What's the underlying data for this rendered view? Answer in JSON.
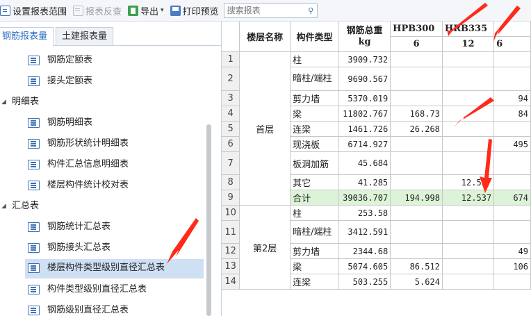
{
  "toolbar": {
    "settings_label": "设置报表范围",
    "check_label": "报表反查",
    "export_label": "导出",
    "print_label": "打印预览",
    "search_placeholder": "搜索报表"
  },
  "tabs": [
    {
      "label": "钢筋报表量",
      "active": true
    },
    {
      "label": "土建报表量",
      "active": false
    }
  ],
  "tree": {
    "items": [
      {
        "type": "doc",
        "label": "钢筋定额表"
      },
      {
        "type": "doc",
        "label": "接头定额表"
      },
      {
        "type": "group",
        "label": "明细表"
      },
      {
        "type": "doc",
        "label": "钢筋明细表"
      },
      {
        "type": "doc",
        "label": "钢筋形状统计明细表"
      },
      {
        "type": "doc",
        "label": "构件汇总信息明细表"
      },
      {
        "type": "doc",
        "label": "楼层构件统计校对表"
      },
      {
        "type": "group",
        "label": "汇总表"
      },
      {
        "type": "doc",
        "label": "钢筋统计汇总表"
      },
      {
        "type": "doc",
        "label": "钢筋接头汇总表"
      },
      {
        "type": "doc",
        "label": "楼层构件类型级别直径汇总表",
        "selected": true
      },
      {
        "type": "doc",
        "label": "构件类型级别直径汇总表"
      },
      {
        "type": "doc",
        "label": "钢筋级别直径汇总表"
      }
    ]
  },
  "table": {
    "headers": {
      "floor": "楼层名称",
      "type": "构件类型",
      "total_line1": "钢筋总重",
      "total_line2": "kg",
      "hpb300": "HPB300",
      "hrb335": "HRB335",
      "d6": "6",
      "d12": "12",
      "d6b": "6"
    },
    "rows": [
      {
        "n": "1",
        "floor": "首层",
        "type": "柱",
        "total": "3909.732",
        "h6": "",
        "h12": "",
        "x6": ""
      },
      {
        "n": "2",
        "floor": "",
        "type": "暗柱/端柱",
        "total": "9690.567",
        "h6": "",
        "h12": "",
        "x6": ""
      },
      {
        "n": "3",
        "floor": "",
        "type": "剪力墙",
        "total": "5370.019",
        "h6": "",
        "h12": "",
        "x6": "94"
      },
      {
        "n": "4",
        "floor": "",
        "type": "梁",
        "total": "11802.767",
        "h6": "168.73",
        "h12": "",
        "x6": "84"
      },
      {
        "n": "5",
        "floor": "",
        "type": "连梁",
        "total": "1461.726",
        "h6": "26.268",
        "h12": "",
        "x6": ""
      },
      {
        "n": "6",
        "floor": "",
        "type": "现浇板",
        "total": "6714.927",
        "h6": "",
        "h12": "",
        "x6": "495"
      },
      {
        "n": "7",
        "floor": "",
        "type": "板洞加筋",
        "total": "45.684",
        "h6": "",
        "h12": "",
        "x6": ""
      },
      {
        "n": "8",
        "floor": "",
        "type": "其它",
        "total": "41.285",
        "h6": "",
        "h12": "12.537",
        "x6": ""
      },
      {
        "n": "9",
        "floor": "",
        "type": "合计",
        "total": "39036.707",
        "h6": "194.998",
        "h12": "12.537",
        "x6": "674"
      },
      {
        "n": "10",
        "floor": "第2层",
        "type": "柱",
        "total": "253.58",
        "h6": "",
        "h12": "",
        "x6": ""
      },
      {
        "n": "11",
        "floor": "",
        "type": "暗柱/端柱",
        "total": "3412.591",
        "h6": "",
        "h12": "",
        "x6": ""
      },
      {
        "n": "12",
        "floor": "",
        "type": "剪力墙",
        "total": "2344.68",
        "h6": "",
        "h12": "",
        "x6": "49"
      },
      {
        "n": "13",
        "floor": "",
        "type": "梁",
        "total": "5074.605",
        "h6": "86.512",
        "h12": "",
        "x6": "106"
      },
      {
        "n": "14",
        "floor": "",
        "type": "连梁",
        "total": "503.255",
        "h6": "5.624",
        "h12": "",
        "x6": ""
      }
    ]
  },
  "colors": {
    "accent": "#2f6fc0",
    "selection": "#cfe0f5",
    "total_row": "#dcf3d8",
    "annotation_arrow": "#ff2a1a"
  }
}
